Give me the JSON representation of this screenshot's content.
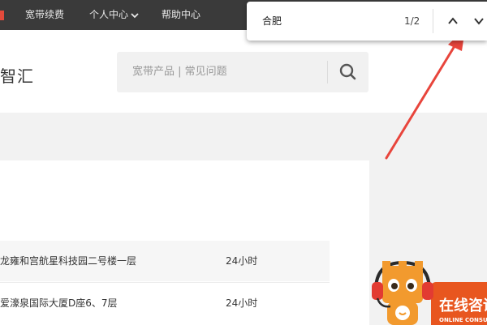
{
  "topnav": {
    "renew_label": "宽带续费",
    "personal_label": "个人中心",
    "help_label": "帮助中心"
  },
  "header": {
    "brand_text": "智汇",
    "search_placeholder": "宽带产品 | 常见问题"
  },
  "find_bar": {
    "query": "合肥",
    "match_count": "1/2"
  },
  "locations": [
    {
      "address": "龙雍和宫航星科技园二号楼一层",
      "hours": "24小时"
    },
    {
      "address": "爱濠泉国际大厦D座6、7层",
      "hours": "24小时"
    }
  ],
  "consult_widget": {
    "title": "在线咨询",
    "subtitle": "ONLINE CONSULT"
  },
  "colors": {
    "topbar_bg": "#3a3a3a",
    "accent_red": "#e8453c",
    "consult_orange": "#e8561f"
  }
}
